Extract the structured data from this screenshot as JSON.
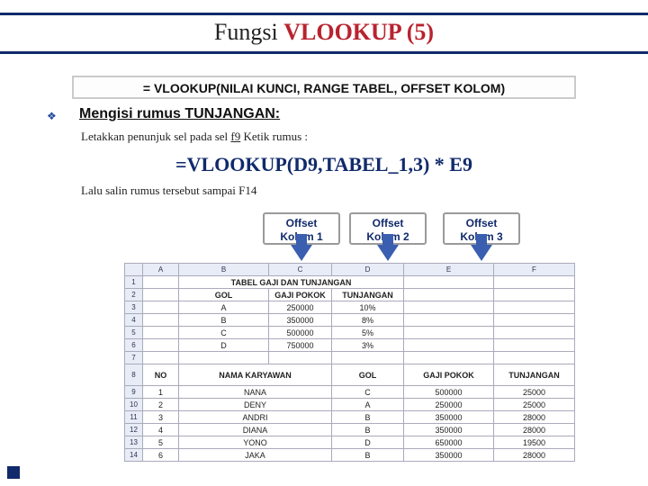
{
  "title": {
    "fun": "Fungsi ",
    "vl": "VLOOKUP (5)"
  },
  "syntax": "= VLOOKUP(NILAI KUNCI, RANGE TABEL, OFFSET KOLOM)",
  "heading": "Mengisi rumus TUNJANGAN:",
  "instr_a": "Letakkan penunjuk sel pada sel ",
  "instr_cell": "f9",
  "instr_b": " Ketik rumus :",
  "formula": "=VLOOKUP(D9,TABEL_1,3) * E9",
  "instr2": "Lalu salin rumus tersebut sampai F14",
  "offsets": {
    "k1a": "Offset",
    "k1b": "Kolom 1",
    "k2a": "Offset",
    "k2b": "Kolom 2",
    "k3a": "Offset",
    "k3b": "Kolom 3"
  },
  "sheet": {
    "cols": [
      "",
      "A",
      "B",
      "C",
      "D",
      "E",
      "F"
    ],
    "row1_title": "TABEL GAJI DAN TUNJANGAN",
    "row2": [
      "GOL",
      "GAJI POKOK",
      "TUNJANGAN"
    ],
    "row3": [
      "A",
      "250000",
      "10%"
    ],
    "row4": [
      "B",
      "350000",
      "8%"
    ],
    "row5": [
      "C",
      "500000",
      "5%"
    ],
    "row6": [
      "D",
      "750000",
      "3%"
    ],
    "row8": [
      "NO",
      "NAMA KARYAWAN",
      "",
      "GOL",
      "GAJI POKOK",
      "TUNJANGAN"
    ],
    "row9": [
      "1",
      "NANA",
      "",
      "C",
      "500000",
      "25000"
    ],
    "row10": [
      "2",
      "DENY",
      "",
      "A",
      "250000",
      "25000"
    ],
    "row11": [
      "3",
      "ANDRI",
      "",
      "B",
      "350000",
      "28000"
    ],
    "row12": [
      "4",
      "DIANA",
      "",
      "B",
      "350000",
      "28000"
    ],
    "row13": [
      "5",
      "YONO",
      "",
      "D",
      "650000",
      "19500"
    ],
    "row14": [
      "6",
      "JAKA",
      "",
      "B",
      "350000",
      "28000"
    ]
  }
}
